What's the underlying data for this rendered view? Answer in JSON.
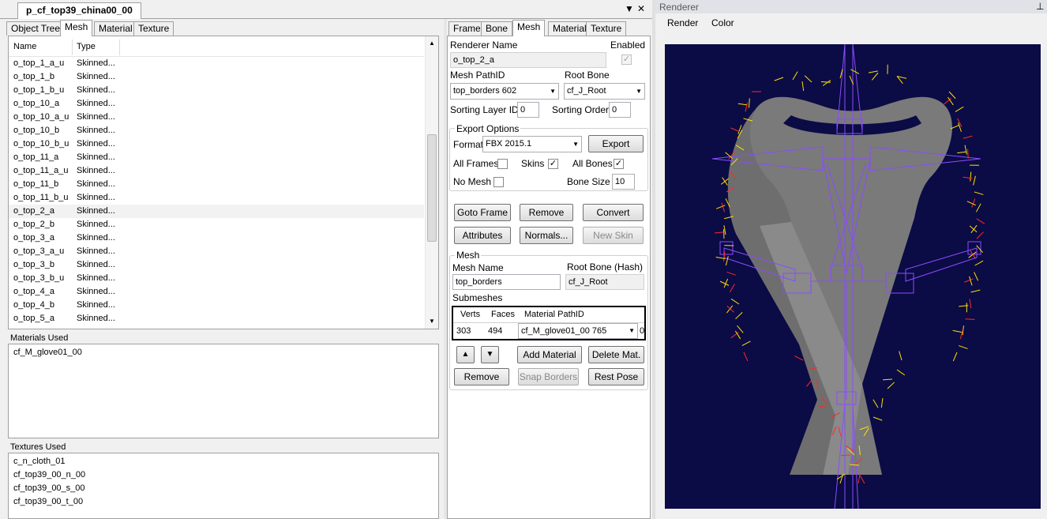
{
  "document": {
    "tab_title": "p_cf_top39_china00_00",
    "menu_glyph": "▼",
    "close_glyph": "✕"
  },
  "left_tabs": [
    "Object Tree",
    "Mesh",
    "Material",
    "Texture"
  ],
  "mesh_list": {
    "headers": [
      "Name",
      "Type"
    ],
    "rows": [
      [
        "o_top_1_a_u",
        "Skinned..."
      ],
      [
        "o_top_1_b",
        "Skinned..."
      ],
      [
        "o_top_1_b_u",
        "Skinned..."
      ],
      [
        "o_top_10_a",
        "Skinned..."
      ],
      [
        "o_top_10_a_u",
        "Skinned..."
      ],
      [
        "o_top_10_b",
        "Skinned..."
      ],
      [
        "o_top_10_b_u",
        "Skinned..."
      ],
      [
        "o_top_11_a",
        "Skinned..."
      ],
      [
        "o_top_11_a_u",
        "Skinned..."
      ],
      [
        "o_top_11_b",
        "Skinned..."
      ],
      [
        "o_top_11_b_u",
        "Skinned..."
      ],
      [
        "o_top_2_a",
        "Skinned..."
      ],
      [
        "o_top_2_b",
        "Skinned..."
      ],
      [
        "o_top_3_a",
        "Skinned..."
      ],
      [
        "o_top_3_a_u",
        "Skinned..."
      ],
      [
        "o_top_3_b",
        "Skinned..."
      ],
      [
        "o_top_3_b_u",
        "Skinned..."
      ],
      [
        "o_top_4_a",
        "Skinned..."
      ],
      [
        "o_top_4_b",
        "Skinned..."
      ],
      [
        "o_top_5_a",
        "Skinned..."
      ]
    ]
  },
  "materials_used": {
    "label": "Materials Used",
    "items": [
      "cf_M_glove01_00"
    ]
  },
  "textures_used": {
    "label": "Textures Used",
    "items": [
      "c_n_cloth_01",
      "cf_top39_00_n_00",
      "cf_top39_00_s_00",
      "cf_top39_00_t_00"
    ]
  },
  "right_tabs": [
    "Frame",
    "Bone",
    "Mesh",
    "Material",
    "Texture"
  ],
  "mesh_editor": {
    "renderer_name_label": "Renderer Name",
    "renderer_name": "o_top_2_a",
    "enabled_label": "Enabled",
    "mesh_pathid_label": "Mesh PathID",
    "mesh_pathid": "top_borders 602",
    "root_bone_label": "Root Bone",
    "root_bone": "cf_J_Root",
    "sorting_layer_label": "Sorting Layer ID",
    "sorting_layer": "0",
    "sorting_order_label": "Sorting Order",
    "sorting_order": "0",
    "export_options_label": "Export Options",
    "format_label": "Format",
    "format": "FBX 2015.1",
    "export_btn": "Export",
    "all_frames_label": "All Frames",
    "skins_label": "Skins",
    "all_bones_label": "All Bones",
    "no_mesh_label": "No Mesh",
    "bone_size_label": "Bone Size",
    "bone_size": "10",
    "goto_frame_btn": "Goto Frame",
    "remove_btn": "Remove",
    "convert_btn": "Convert",
    "attributes_btn": "Attributes",
    "normals_btn": "Normals...",
    "new_skin_btn": "New Skin",
    "mesh_group_label": "Mesh",
    "mesh_name_label": "Mesh Name",
    "mesh_name": "top_borders",
    "root_bone_hash_label": "Root Bone (Hash)",
    "root_bone_hash": "cf_J_Root",
    "submeshes_label": "Submeshes",
    "submesh_headers": [
      "Verts",
      "Faces",
      "Material PathID"
    ],
    "submesh_row": {
      "verts": "303",
      "faces": "494",
      "material": "cf_M_glove01_00 765",
      "extra": "0"
    },
    "add_material_btn": "Add Material",
    "delete_mat_btn": "Delete Mat.",
    "remove2_btn": "Remove",
    "snap_borders_btn": "Snap Borders",
    "rest_pose_btn": "Rest Pose",
    "up_glyph": "▲",
    "down_glyph": "▼",
    "check_glyph": "✓"
  },
  "renderer": {
    "title": "Renderer",
    "pin_glyph": "⊥",
    "menu": [
      "Render",
      "Color"
    ],
    "background": "#0b0b45"
  }
}
